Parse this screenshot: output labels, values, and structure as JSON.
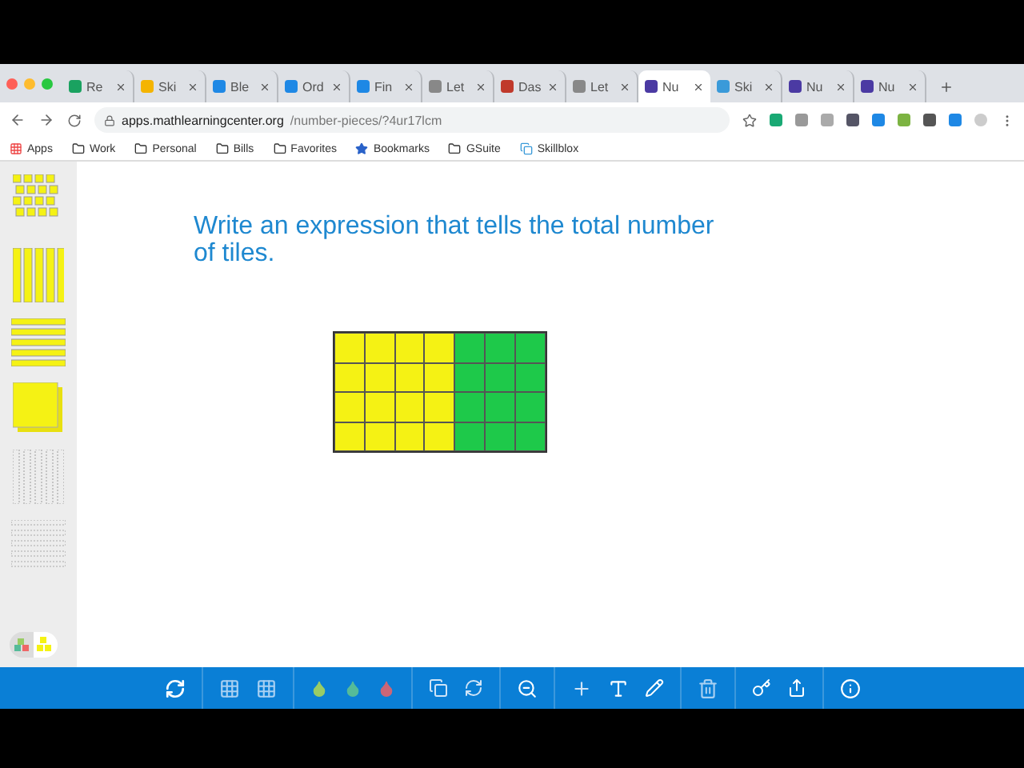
{
  "browser": {
    "tabs": [
      {
        "label": "Re",
        "selected": false
      },
      {
        "label": "Ski",
        "selected": false
      },
      {
        "label": "Ble",
        "selected": false
      },
      {
        "label": "Ord",
        "selected": false
      },
      {
        "label": "Fin",
        "selected": false
      },
      {
        "label": "Let",
        "selected": false
      },
      {
        "label": "Das",
        "selected": false
      },
      {
        "label": "Let",
        "selected": false
      },
      {
        "label": "Nu",
        "selected": true
      },
      {
        "label": "Ski",
        "selected": false
      },
      {
        "label": "Nu",
        "selected": false
      },
      {
        "label": "Nu",
        "selected": false
      }
    ],
    "address": {
      "host": "apps.mathlearningcenter.org",
      "path": "/number-pieces/?4ur17lcm"
    },
    "bookmarks": [
      "Apps",
      "Work",
      "Personal",
      "Bills",
      "Favorites",
      "Bookmarks",
      "GSuite",
      "Skillblox"
    ]
  },
  "color_modes": [
    {
      "selected": false
    },
    {
      "selected": true
    }
  ],
  "prompt": "Write an expression that tells the total number of tiles.",
  "tiles": [
    [
      {
        "color": "#f5f214"
      },
      {
        "color": "#f5f214"
      },
      {
        "color": "#f5f214"
      },
      {
        "color": "#f5f214"
      },
      {
        "color": "#1ec94a"
      },
      {
        "color": "#1ec94a"
      },
      {
        "color": "#1ec94a"
      }
    ],
    [
      {
        "color": "#f5f214"
      },
      {
        "color": "#f5f214"
      },
      {
        "color": "#f5f214"
      },
      {
        "color": "#f5f214"
      },
      {
        "color": "#1ec94a"
      },
      {
        "color": "#1ec94a"
      },
      {
        "color": "#1ec94a"
      }
    ],
    [
      {
        "color": "#f5f214"
      },
      {
        "color": "#f5f214"
      },
      {
        "color": "#f5f214"
      },
      {
        "color": "#f5f214"
      },
      {
        "color": "#1ec94a"
      },
      {
        "color": "#1ec94a"
      },
      {
        "color": "#1ec94a"
      }
    ],
    [
      {
        "color": "#f5f214"
      },
      {
        "color": "#f5f214"
      },
      {
        "color": "#f5f214"
      },
      {
        "color": "#f5f214"
      },
      {
        "color": "#1ec94a"
      },
      {
        "color": "#1ec94a"
      },
      {
        "color": "#1ec94a"
      }
    ]
  ]
}
